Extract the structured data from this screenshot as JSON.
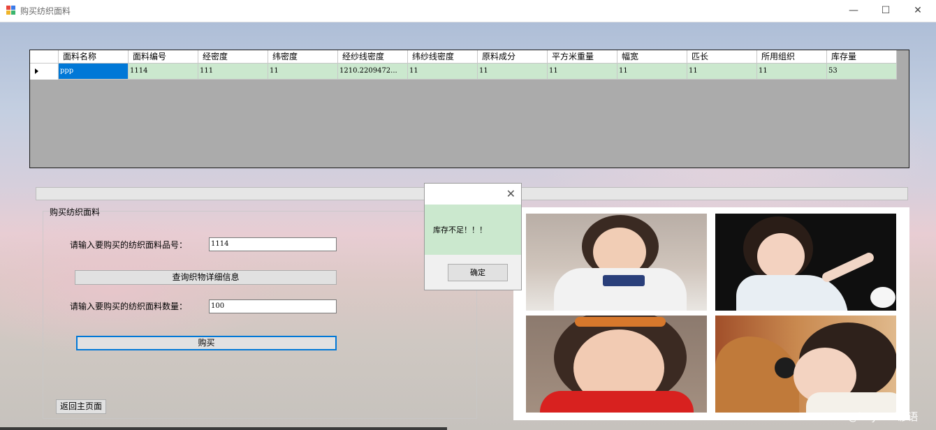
{
  "window": {
    "title": "购买纺织面料",
    "minimize": "—",
    "maximize": "☐",
    "close": "✕"
  },
  "grid": {
    "columns": [
      "面料名称",
      "面料编号",
      "经密度",
      "纬密度",
      "经纱线密度",
      "纬纱线密度",
      "原料成分",
      "平方米重量",
      "幅宽",
      "匹长",
      "所用组织",
      "库存量"
    ],
    "rows": [
      [
        "ppp",
        "1114",
        "111",
        "11",
        "1210.2209472...",
        "11",
        "11",
        "11",
        "11",
        "11",
        "11",
        "53"
      ]
    ]
  },
  "form": {
    "group_title": "购买纺织面料",
    "code_label": "请输入要购买的纺织面料品号：",
    "code_value": "1114",
    "query_button": "查询织物详细信息",
    "quantity_label": "请输入要购买的纺织面料数量：",
    "quantity_value": "100",
    "buy_button": "购买",
    "back_button": "返回主页面"
  },
  "progress": {
    "value": 0
  },
  "dialog": {
    "close": "✕",
    "message": "库存不足！！！",
    "ok_button": "确定"
  },
  "watermark": "CSDN @beyond谚语",
  "colors": {
    "selected_cell": "#0078d7",
    "row_background": "#cbe8ce",
    "grid_background": "#ababab",
    "focus_border": "#0078d7"
  },
  "icons": [
    "app-icon",
    "minimize-icon",
    "maximize-icon",
    "close-icon",
    "row-pointer-icon"
  ]
}
